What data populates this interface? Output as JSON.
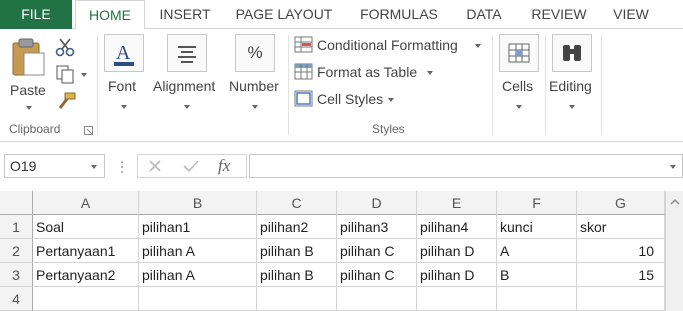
{
  "tabs": {
    "file": "FILE",
    "home": "HOME",
    "insert": "INSERT",
    "page_layout": "PAGE LAYOUT",
    "formulas": "FORMULAS",
    "data": "DATA",
    "review": "REVIEW",
    "view": "VIEW"
  },
  "ribbon": {
    "paste": "Paste",
    "clipboard_group": "Clipboard",
    "font": "Font",
    "alignment": "Alignment",
    "number": "Number",
    "number_symbol": "%",
    "conditional_formatting": "Conditional Formatting",
    "format_as_table": "Format as Table",
    "cell_styles": "Cell Styles",
    "styles_group": "Styles",
    "cells": "Cells",
    "editing": "Editing"
  },
  "formula_bar": {
    "name_box": "O19",
    "fx": "fx",
    "value": ""
  },
  "grid": {
    "columns": [
      "A",
      "B",
      "C",
      "D",
      "E",
      "F",
      "G"
    ],
    "rows": [
      "1",
      "2",
      "3",
      "4"
    ],
    "cells": [
      [
        "Soal",
        "pilihan1",
        "pilihan2",
        "pilihan3",
        "pilihan4",
        "kunci",
        "skor"
      ],
      [
        "Pertanyaan1",
        "pilihan A",
        "pilihan B",
        "pilihan C",
        "pilihan D",
        "A",
        "10"
      ],
      [
        "Pertanyaan2",
        "pilihan A",
        "pilihan B",
        "pilihan C",
        "pilihan D",
        "B",
        "15"
      ],
      [
        "",
        "",
        "",
        "",
        "",
        "",
        ""
      ]
    ]
  },
  "colors": {
    "file_tab": "#217346",
    "active_tab_text": "#217346"
  }
}
